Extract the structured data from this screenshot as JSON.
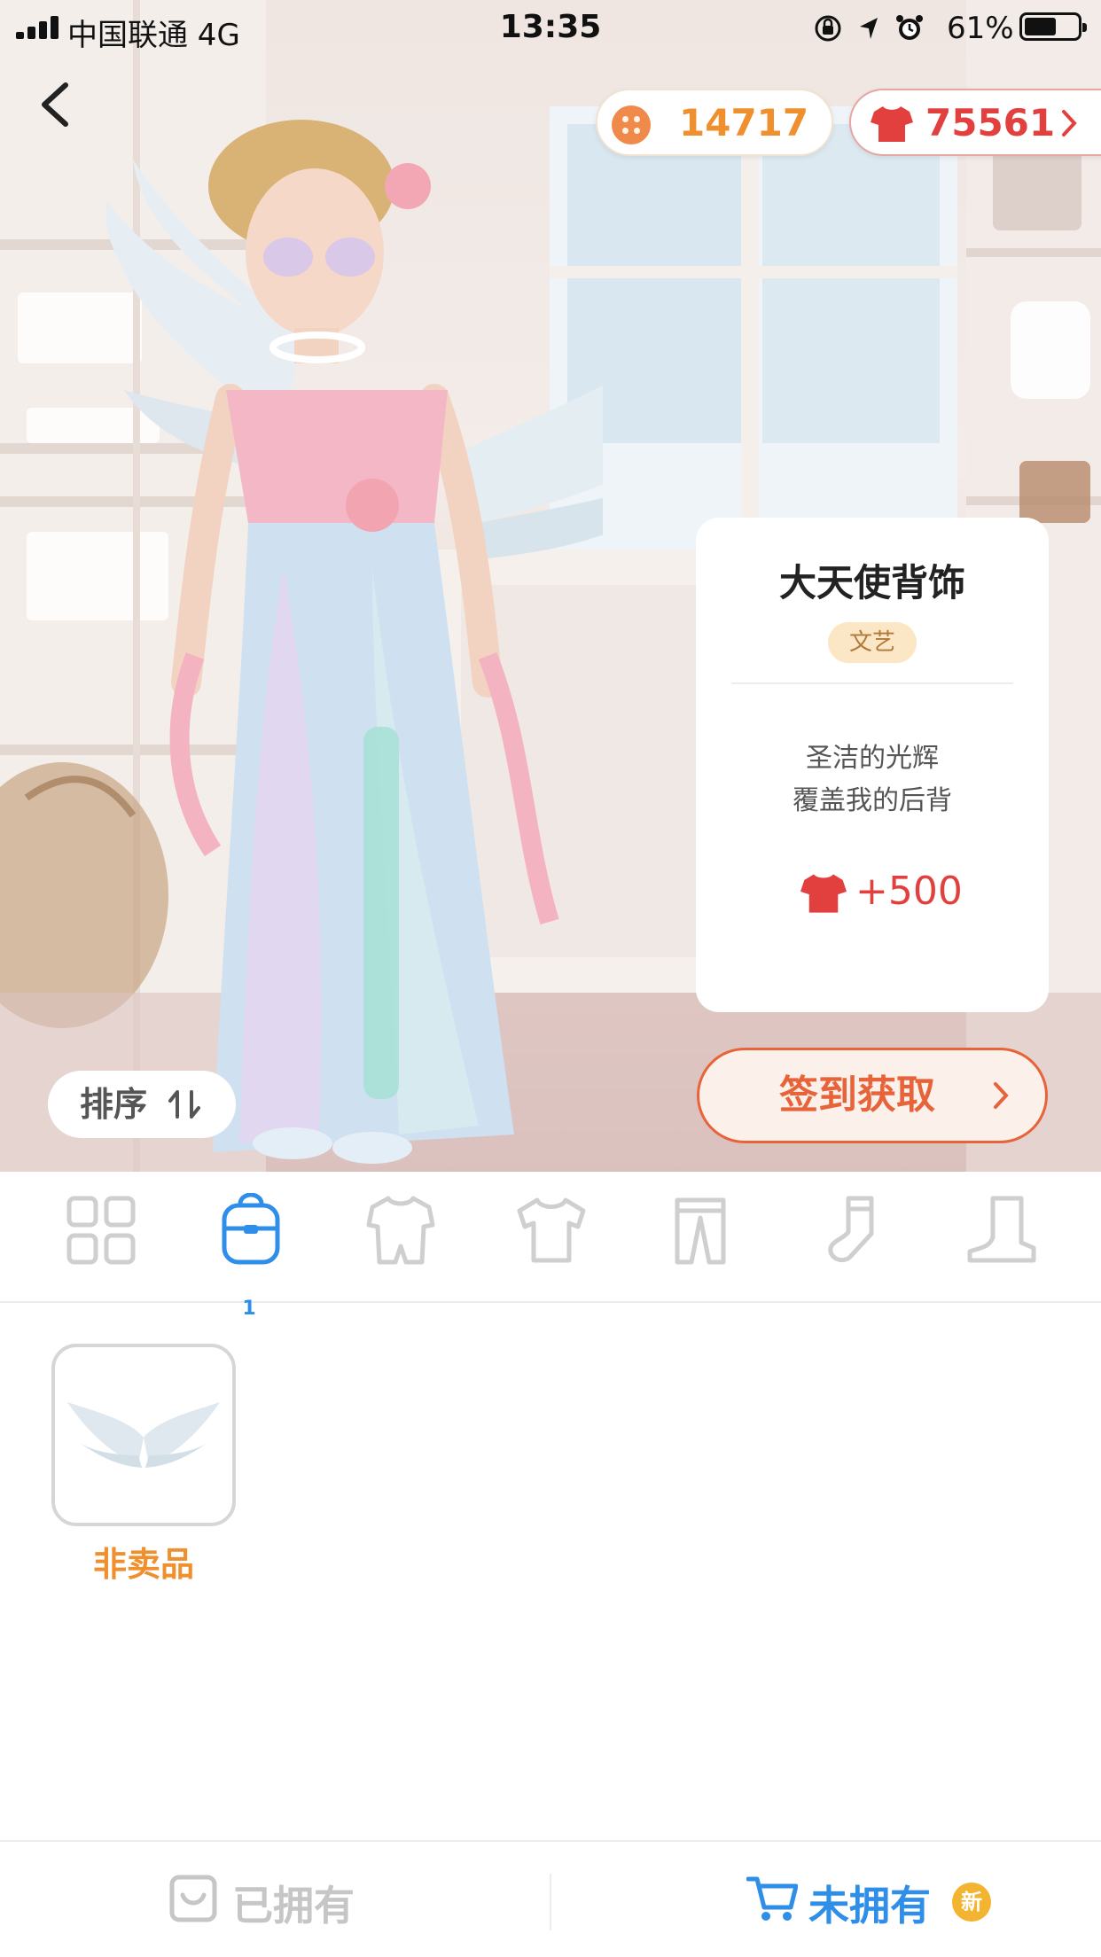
{
  "status_bar": {
    "carrier": "中国联通   4G",
    "time": "13:35",
    "battery_percent": "61%",
    "battery_level": 0.61
  },
  "currency": {
    "coins": "14717",
    "shirts": "75561"
  },
  "item_info": {
    "title": "大天使背饰",
    "tag": "文艺",
    "description_line1": "圣洁的光辉",
    "description_line2": "覆盖我的后背",
    "reward": "+500"
  },
  "controls": {
    "sort_label": "排序",
    "signin_label": "签到获取"
  },
  "category_tabs": [
    {
      "name": "all",
      "icon": "grid-icon"
    },
    {
      "name": "backpack",
      "icon": "backpack-icon",
      "badge": "1",
      "active": true
    },
    {
      "name": "onesie",
      "icon": "onesie-icon"
    },
    {
      "name": "tshirt",
      "icon": "tshirt-icon"
    },
    {
      "name": "pants",
      "icon": "pants-icon"
    },
    {
      "name": "socks",
      "icon": "sock-icon"
    },
    {
      "name": "boots",
      "icon": "boot-icon"
    }
  ],
  "items": [
    {
      "label": "非卖品",
      "icon": "angel-wings-icon"
    }
  ],
  "bottom_tabs": {
    "owned": "已拥有",
    "unowned": "未拥有",
    "new_badge": "新"
  },
  "colors": {
    "accent_blue": "#2f8ee8",
    "accent_orange": "#ef8f2e",
    "accent_red": "#e2403e",
    "signin_orange": "#e7643a"
  }
}
